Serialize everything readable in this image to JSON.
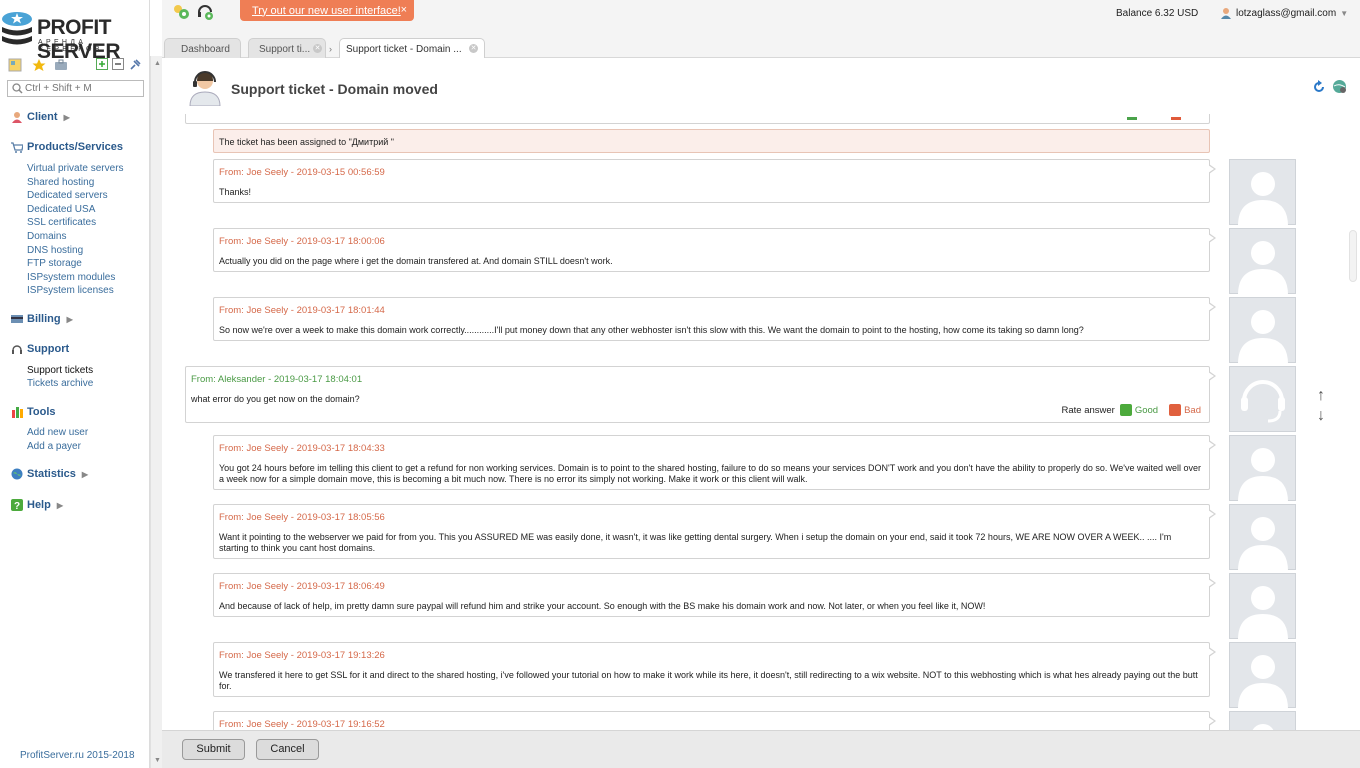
{
  "brand": {
    "title_prefix": "PROFIT",
    "title_suffix": " SERVER",
    "subtitle": "АРЕНДА СЕРВЕРОВ",
    "footer": "ProfitServer.ru 2015-2018"
  },
  "search": {
    "placeholder": "Ctrl + Shift + M"
  },
  "nav": {
    "client": "Client",
    "products": "Products/Services",
    "products_items": [
      "Virtual private servers",
      "Shared hosting",
      "Dedicated servers",
      "Dedicated USA",
      "SSL certificates",
      "Domains",
      "DNS hosting",
      "FTP storage",
      "ISPsystem modules",
      "ISPsystem licenses"
    ],
    "billing": "Billing",
    "support": "Support",
    "support_items": [
      "Support tickets",
      "Tickets archive"
    ],
    "tools": "Tools",
    "tools_items": [
      "Add new user",
      "Add a payer"
    ],
    "statistics": "Statistics",
    "help": "Help"
  },
  "topbar": {
    "banner": "Try out our new user interface!",
    "banner_close": "×",
    "balance": "Balance 6.32 USD",
    "user": "lotzaglass@gmail.com"
  },
  "tabs": {
    "dashboard": "Dashboard",
    "tab2": "Support ti...",
    "tab3": "Support ticket - Domain ..."
  },
  "page": {
    "title": "Support ticket - Domain moved"
  },
  "ticket": {
    "system_note": "The ticket has been assigned to \"Дмитрий \"",
    "messages": [
      {
        "from": "From: Joe Seely - 2019-03-15 00:56:59",
        "body": "Thanks!"
      },
      {
        "from": "From: Joe Seely - 2019-03-17 18:00:06",
        "body": "Actually you did on the page where i get the domain transfered at. And domain STILL doesn't work."
      },
      {
        "from": "From: Joe Seely - 2019-03-17 18:01:44",
        "body": "So now we're over a week to make this domain work correctly............I'll put money down that any other webhoster isn't this slow with this. We want the domain to point to the hosting, how come its taking so damn long?"
      },
      {
        "from": "From: Aleksander - 2019-03-17 18:04:01",
        "body": "what error do you get now on the domain?"
      },
      {
        "from": "From: Joe Seely - 2019-03-17 18:04:33",
        "body": "You got 24 hours before im telling this client to get a refund for non working services. Domain is to point to the shared hosting, failure to do so means your services DON'T work and you don't have the ability to properly do so. We've waited well over a week now for a simple domain move, this is becoming a bit much now. There is no error its simply not working. Make it work or this client will walk."
      },
      {
        "from": "From: Joe Seely - 2019-03-17 18:05:56",
        "body": "Want it pointing to the webserver we paid for from you. This you ASSURED ME was easily done, it wasn't, it was like getting dental surgery. When i setup the domain on your end, said it took 72 hours, WE ARE NOW OVER A WEEK.. .... I'm starting to think you cant host domains."
      },
      {
        "from": "From: Joe Seely - 2019-03-17 18:06:49",
        "body": "And because of lack of help, im pretty damn sure paypal will refund him and strike your account. So enough with the BS make his domain work and now. Not later, or when you feel like it, NOW!"
      },
      {
        "from": "From: Joe Seely - 2019-03-17 19:13:26",
        "body": "We transfered it here to get SSL for it and direct to the shared hosting, i've followed your tutorial on how to make it work while its here, it doesn't, still redirecting to a wix website. NOT to this webhosting which is what hes already paying out the butt for."
      },
      {
        "from": "From: Joe Seely - 2019-03-17 19:16:52",
        "body": ""
      }
    ],
    "rate_label": "Rate answer",
    "rate_good": "Good",
    "rate_bad": "Bad"
  },
  "actions": {
    "submit": "Submit",
    "cancel": "Cancel"
  },
  "colors": {
    "customer": "#d5694a",
    "staff": "#4a9a45",
    "banner": "#ef7e55",
    "link": "#3a6d9c"
  }
}
